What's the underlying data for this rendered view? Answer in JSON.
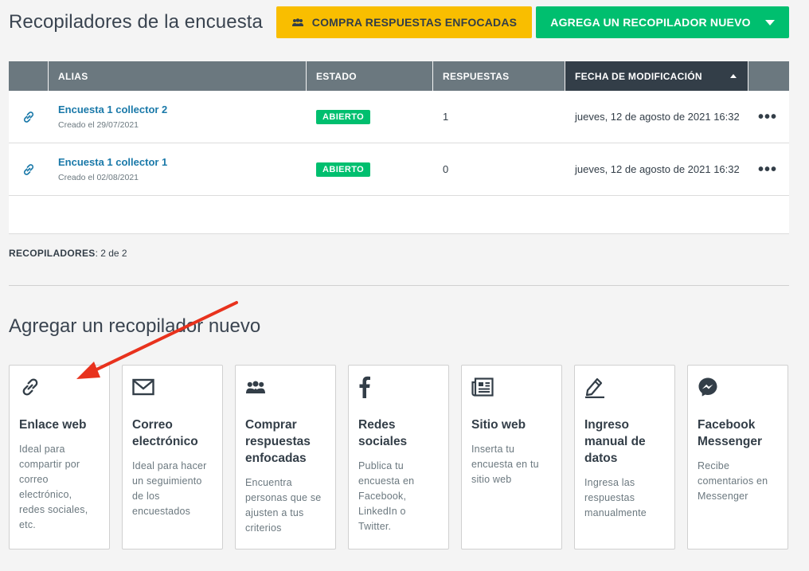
{
  "header": {
    "title": "Recopiladores de la encuesta",
    "buy_button": "COMPRA RESPUESTAS ENFOCADAS",
    "add_button": "AGREGA UN RECOPILADOR NUEVO"
  },
  "table": {
    "columns": [
      "",
      "ALIAS",
      "ESTADO",
      "RESPUESTAS",
      "FECHA DE MODIFICACIÓN",
      ""
    ],
    "rows": [
      {
        "alias": "Encuesta 1 collector 2",
        "created": "Creado el 29/07/2021",
        "status": "ABIERTO",
        "responses": "1",
        "modified": "jueves, 12 de agosto de 2021 16:32"
      },
      {
        "alias": "Encuesta 1 collector 1",
        "created": "Creado el 02/08/2021",
        "status": "ABIERTO",
        "responses": "0",
        "modified": "jueves, 12 de agosto de 2021 16:32"
      }
    ]
  },
  "count": {
    "label": "RECOPILADORES",
    "value": ": 2 de 2"
  },
  "add_section": {
    "title": "Agregar un recopilador nuevo",
    "cards": [
      {
        "icon": "link-icon",
        "title": "Enlace web",
        "desc": "Ideal para compartir por correo electrónico, redes sociales, etc."
      },
      {
        "icon": "envelope-icon",
        "title": "Correo electrónico",
        "desc": "Ideal para hacer un seguimiento de los encuestados"
      },
      {
        "icon": "people-icon",
        "title": "Comprar respuestas enfocadas",
        "desc": "Encuentra personas que se ajusten a tus criterios"
      },
      {
        "icon": "facebook-icon",
        "title": "Redes sociales",
        "desc": "Publica tu encuesta en Facebook, LinkedIn o Twitter."
      },
      {
        "icon": "newspaper-icon",
        "title": "Sitio web",
        "desc": "Inserta tu encuesta en tu sitio web"
      },
      {
        "icon": "pencil-icon",
        "title": "Ingreso manual de datos",
        "desc": "Ingresa las respuestas manualmente"
      },
      {
        "icon": "messenger-icon",
        "title": "Facebook Messenger",
        "desc": "Recibe comentarios en Messenger"
      }
    ]
  },
  "colors": {
    "primary_green": "#00bf6f",
    "accent_yellow": "#f9be00",
    "link_blue": "#1a79a9",
    "arrow_red": "#e8321d"
  }
}
